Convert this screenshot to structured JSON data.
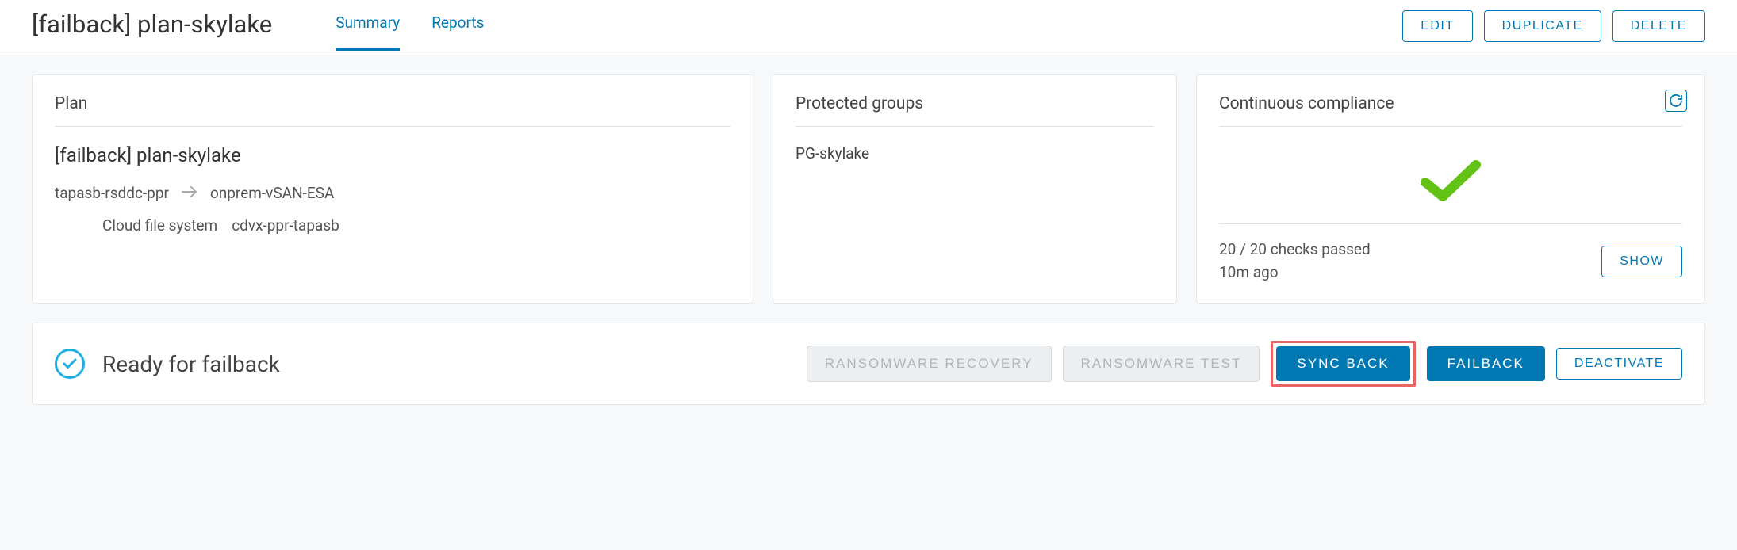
{
  "header": {
    "title": "[failback] plan-skylake",
    "tabs": [
      {
        "label": "Summary",
        "active": true
      },
      {
        "label": "Reports",
        "active": false
      }
    ],
    "actions": {
      "edit": "EDIT",
      "duplicate": "DUPLICATE",
      "delete": "DELETE"
    }
  },
  "plan_card": {
    "title": "Plan",
    "name": "[failback] plan-skylake",
    "source": "tapasb-rsddc-ppr",
    "target": "onprem-vSAN-ESA",
    "cfs_label": "Cloud file system",
    "cfs_value": "cdvx-ppr-tapasb"
  },
  "pg_card": {
    "title": "Protected groups",
    "items": [
      "PG-skylake"
    ]
  },
  "cc_card": {
    "title": "Continuous compliance",
    "passed": 20,
    "total": 20,
    "summary": "20 / 20 checks passed",
    "time": "10m ago",
    "show_label": "SHOW"
  },
  "status": {
    "text": "Ready for failback",
    "buttons": {
      "ransomware_recovery": "RANSOMWARE RECOVERY",
      "ransomware_test": "RANSOMWARE TEST",
      "sync_back": "SYNC BACK",
      "failback": "FAILBACK",
      "deactivate": "DEACTIVATE"
    }
  }
}
